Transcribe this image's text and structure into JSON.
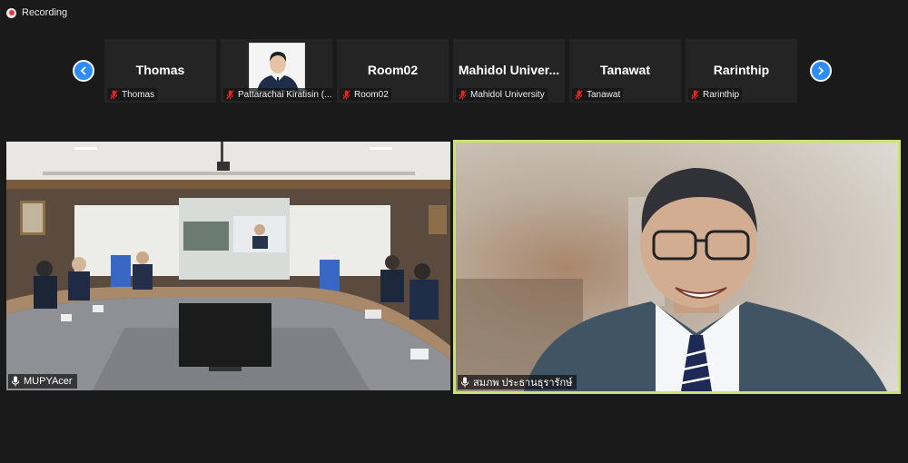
{
  "recording": {
    "label": "Recording"
  },
  "nav": {
    "prev_icon": "chevron-left-icon",
    "next_icon": "chevron-right-icon"
  },
  "thumbnails": [
    {
      "display": "Thomas",
      "label": "Thomas",
      "muted": true
    },
    {
      "display": "",
      "label": "Pattarachai Kiratisin (...",
      "muted": true,
      "has_photo": true
    },
    {
      "display": "Room02",
      "label": "Room02",
      "muted": true
    },
    {
      "display": "Mahidol Univer...",
      "label": "Mahidol University",
      "muted": true
    },
    {
      "display": "Tanawat",
      "label": "Tanawat",
      "muted": true
    },
    {
      "display": "Rarinthip",
      "label": "Rarinthip",
      "muted": true
    }
  ],
  "videos": {
    "room": {
      "label": "MUPYAcer",
      "icon": "microphone-icon"
    },
    "speaker": {
      "label": "สมภพ ประธานธุรารักษ์",
      "icon": "microphone-icon"
    }
  },
  "colors": {
    "accent": "#2d8cff",
    "active_speaker_border": "#c9e36c",
    "mute": "#e02828",
    "background": "#1a1a1a"
  }
}
